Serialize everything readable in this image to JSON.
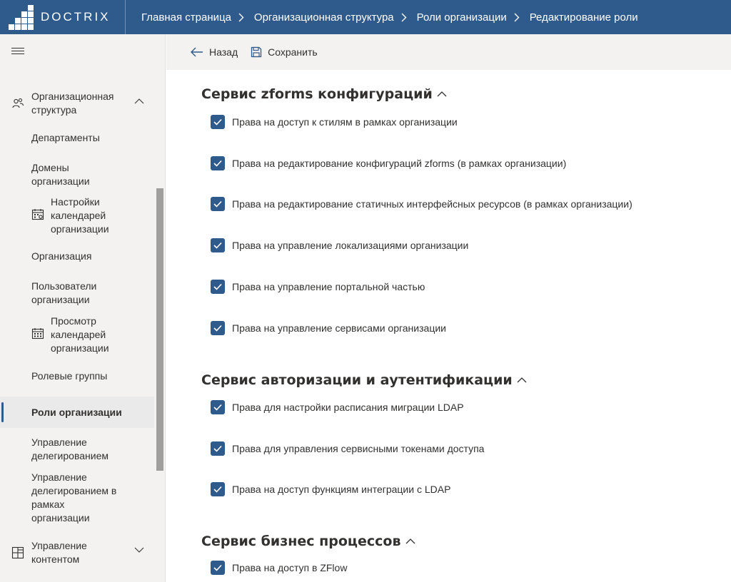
{
  "header": {
    "brand": "DOCTRIX",
    "breadcrumbs": [
      "Главная страница",
      "Организационная структура",
      "Роли организации",
      "Редактирование роли"
    ]
  },
  "sidebar": {
    "items": [
      {
        "label": "Организационная структура",
        "icon": "people-icon",
        "expand": "chevron-up-icon"
      },
      {
        "label": "Департаменты"
      },
      {
        "label": "Домены организации"
      },
      {
        "label": "Настройки календарей организации",
        "icon": "calendar-settings-icon"
      },
      {
        "label": "Организация"
      },
      {
        "label": "Пользователи организации"
      },
      {
        "label": "Просмотр календарей организации",
        "icon": "calendar-icon"
      },
      {
        "label": "Ролевые группы"
      },
      {
        "label": "Роли организации",
        "active": true
      },
      {
        "label": "Управление делегированием"
      },
      {
        "label": "Управление делегированием в рамках организации"
      },
      {
        "label": "Управление контентом",
        "icon": "content-grid-icon",
        "expand": "chevron-down-icon"
      }
    ]
  },
  "toolbar": {
    "back_label": "Назад",
    "save_label": "Сохранить"
  },
  "sections": [
    {
      "title": "Сервис zforms конфигураций",
      "permissions": [
        {
          "label": "Права на доступ к стилям в рамках организации",
          "checked": true
        },
        {
          "label": "Права на редактирование конфигураций zforms (в рамках организации)",
          "checked": true
        },
        {
          "label": "Права на редактирование статичных интерфейсных ресурсов (в рамках организации)",
          "checked": true
        },
        {
          "label": "Права на управление локализациями организации",
          "checked": true
        },
        {
          "label": "Права на управление портальной частью",
          "checked": true
        },
        {
          "label": "Права на управление сервисами организации",
          "checked": true
        }
      ]
    },
    {
      "title": "Сервис авторизации и аутентификации",
      "permissions": [
        {
          "label": "Права для настройки расписания миграции LDAP",
          "checked": true
        },
        {
          "label": "Права для управления сервисными токенами доступа",
          "checked": true
        },
        {
          "label": "Права на доступ функциям интеграции с LDAP",
          "checked": true
        }
      ]
    },
    {
      "title": "Сервис бизнес процессов",
      "permissions": [
        {
          "label": "Права на доступ в ZFlow",
          "checked": true
        }
      ]
    }
  ],
  "colors": {
    "header_bg": "#2f5a8c",
    "accent": "#2f5a8c",
    "sidebar_bg": "#f3f2f1",
    "checkbox_fill": "#2f5a8c"
  }
}
